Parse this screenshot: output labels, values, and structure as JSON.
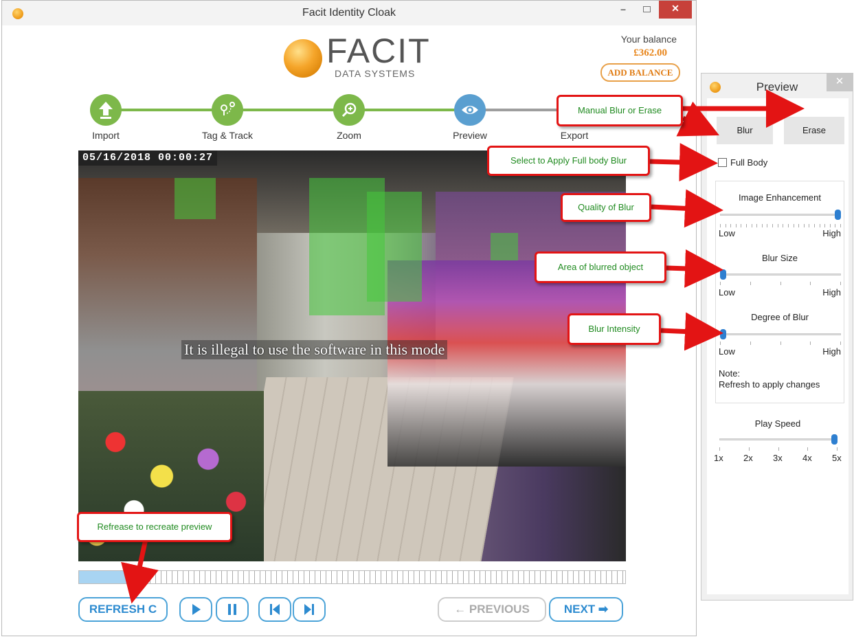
{
  "window": {
    "title": "Facit Identity Cloak"
  },
  "logo": {
    "name": "FACIT",
    "subtitle": "DATA SYSTEMS"
  },
  "balance": {
    "label": "Your balance",
    "amount": "£362.00",
    "add_button": "ADD BALANCE"
  },
  "steps": [
    {
      "label": "Import",
      "color": "#7db84a",
      "icon": "upload-icon"
    },
    {
      "label": "Tag & Track",
      "color": "#7db84a",
      "icon": "tag-track-icon"
    },
    {
      "label": "Zoom",
      "color": "#7db84a",
      "icon": "zoom-icon"
    },
    {
      "label": "Preview",
      "color": "#5a9fd0",
      "icon": "eye-icon"
    },
    {
      "label": "Export",
      "color": "#9e9e9e",
      "icon": "export-icon"
    }
  ],
  "video": {
    "timestamp": "05/16/2018 00:00:27",
    "watermark": "It is illegal to use the software in this mode"
  },
  "timeline": {
    "progress": 0.09
  },
  "controls": {
    "refresh": "REFRESH C",
    "previous": "← PREVIOUS",
    "next": "NEXT ➡"
  },
  "panel": {
    "title": "Preview",
    "blur_button": "Blur",
    "erase_button": "Erase",
    "full_body_label": "Full Body",
    "full_body_checked": false,
    "image_enhancement": {
      "label": "Image Enhancement",
      "low": "Low",
      "high": "High",
      "value": 1.0
    },
    "blur_size": {
      "label": "Blur Size",
      "low": "Low",
      "high": "High",
      "value": 0.0
    },
    "degree_of_blur": {
      "label": "Degree of Blur",
      "low": "Low",
      "high": "High",
      "value": 0.0
    },
    "note_title": "Note:",
    "note_text": "Refresh to apply changes",
    "play_speed": {
      "label": "Play Speed",
      "options": [
        "1x",
        "2x",
        "3x",
        "4x",
        "5x"
      ],
      "value": "5x"
    }
  },
  "annotations": {
    "manual_blur": "Manual Blur or Erase",
    "full_body": "Select to Apply Full body Blur",
    "quality": "Quality of Blur",
    "area": "Area of blurred object",
    "intensity": "Blur Intensity",
    "refresh": "Refrease to recreate preview"
  },
  "colors": {
    "accent_blue": "#2d8bd0",
    "orange": "#e8851a",
    "green": "#7db84a",
    "annotation_red": "#e31414",
    "annotation_text": "#1f8a1f"
  }
}
